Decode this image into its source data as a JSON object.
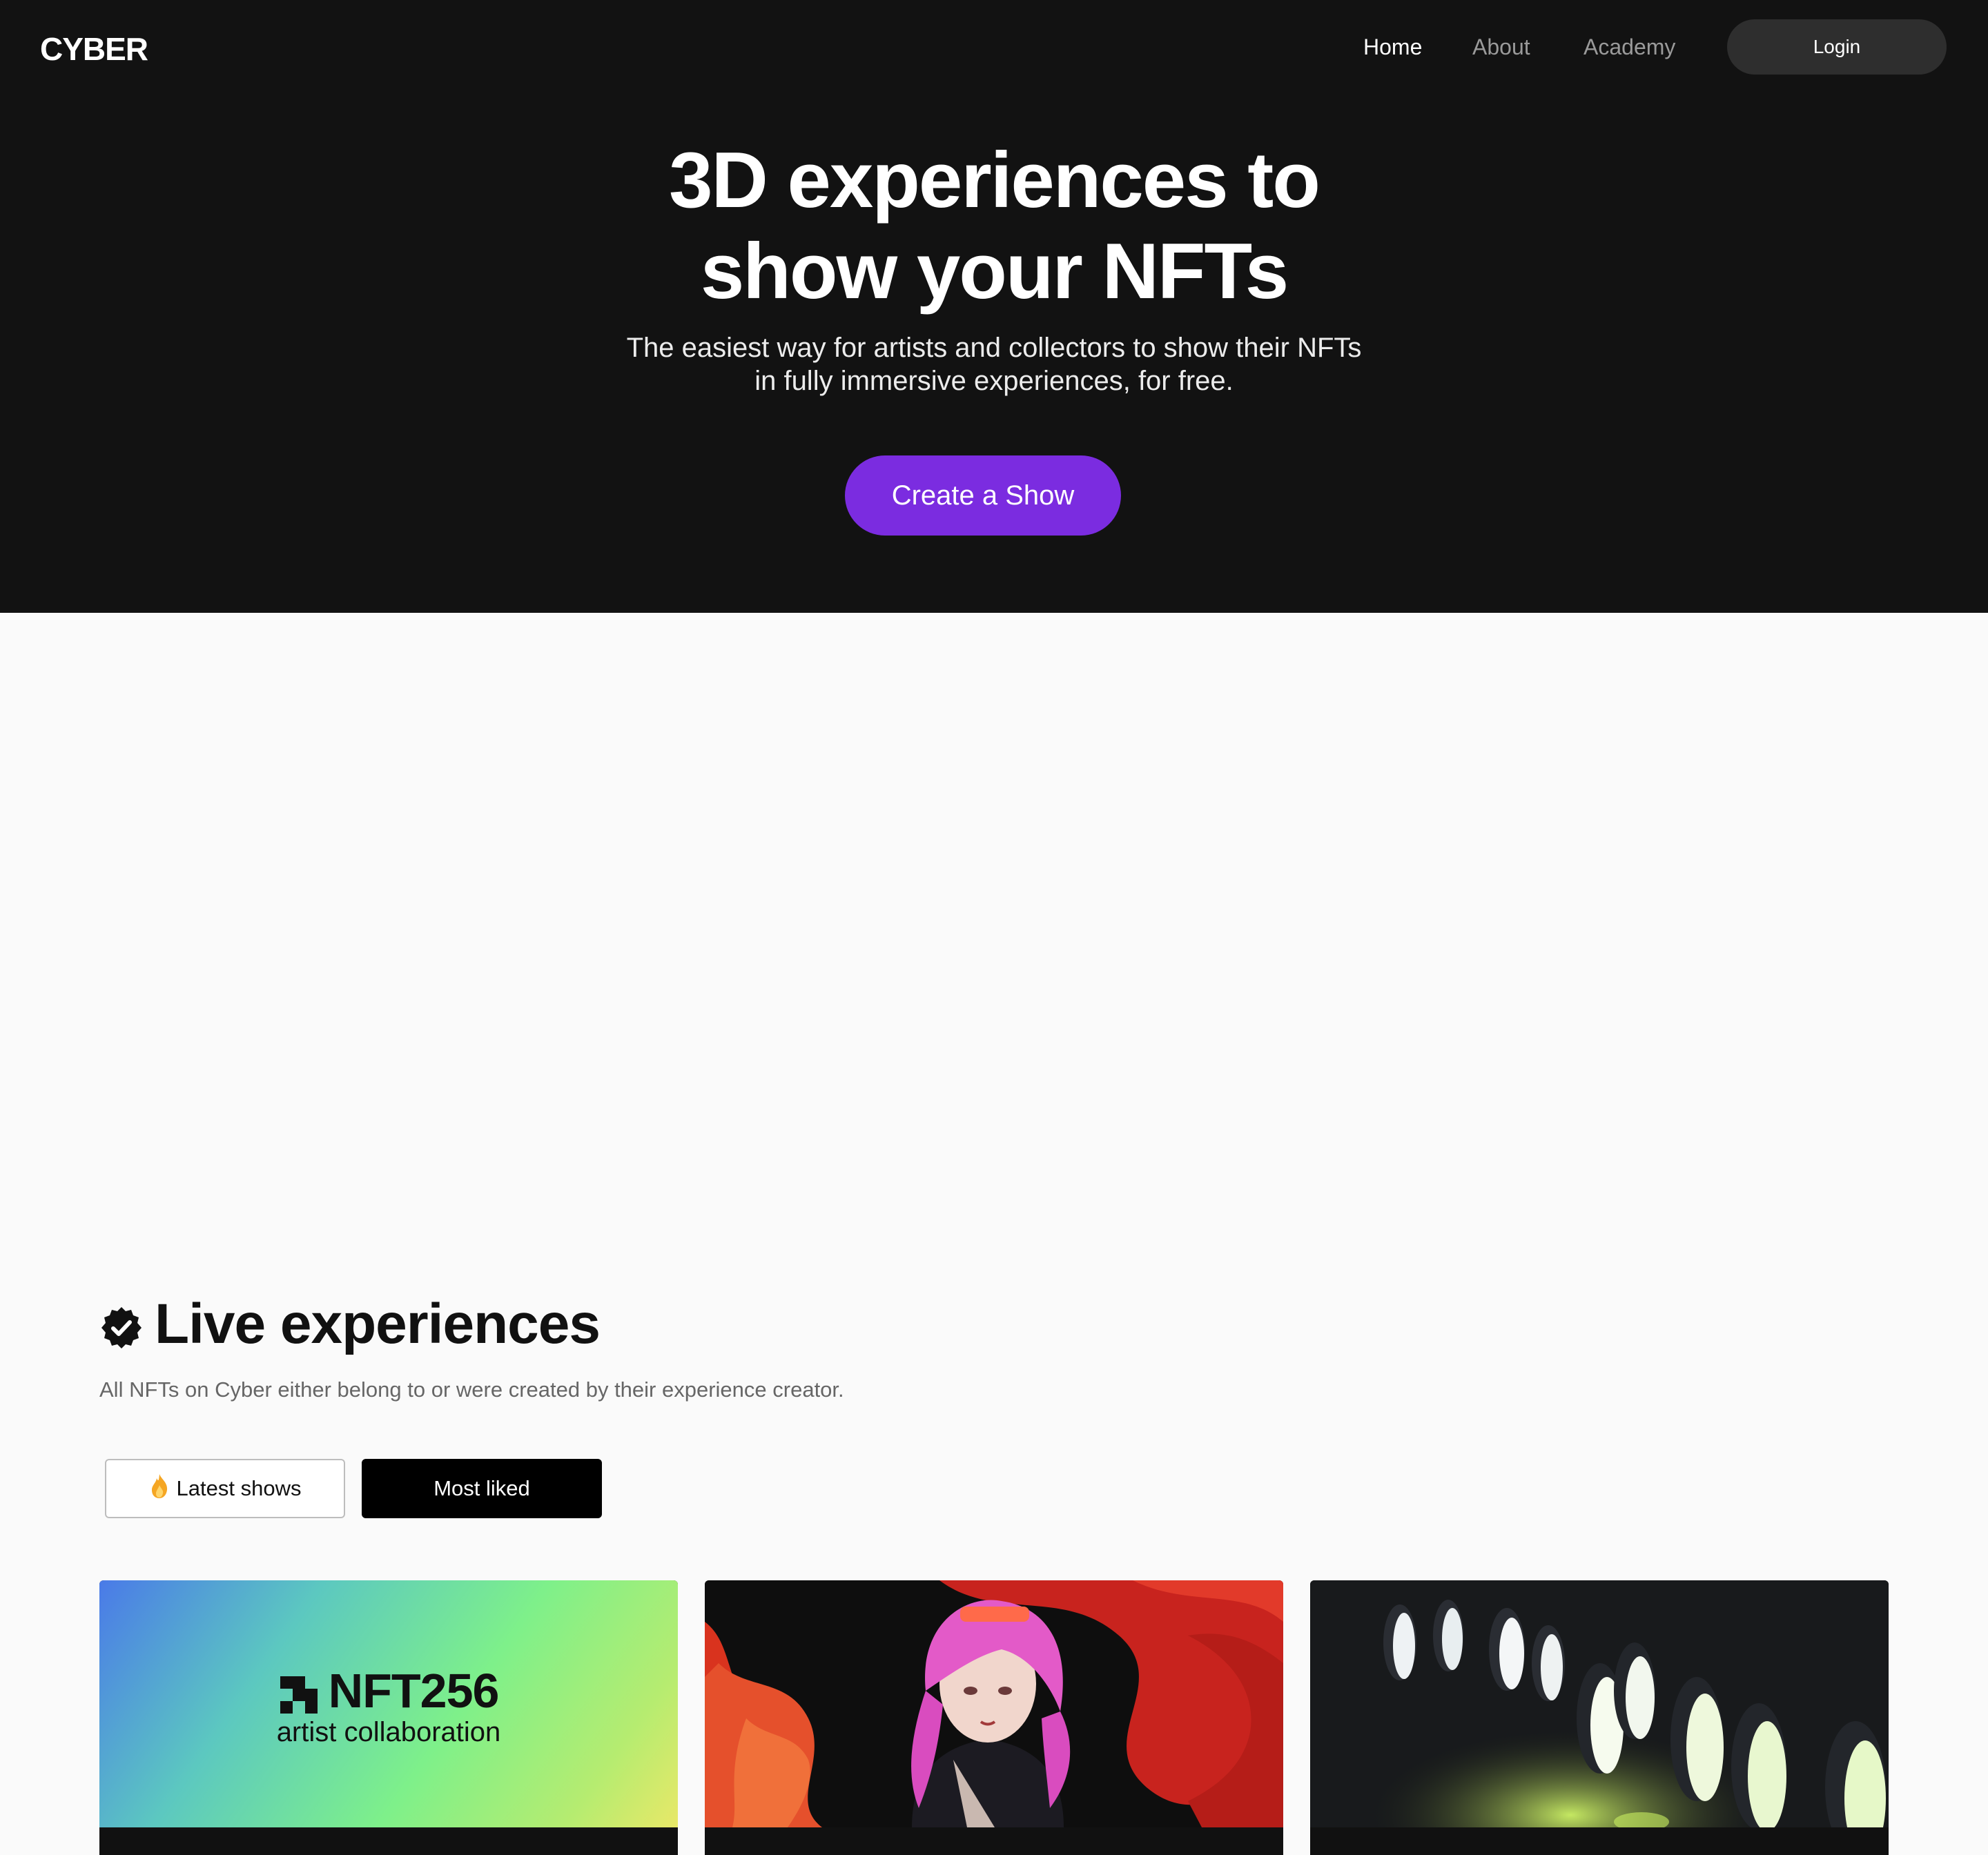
{
  "header": {
    "logo": "CYBER",
    "nav": [
      {
        "label": "Home",
        "active": true
      },
      {
        "label": "About",
        "active": false
      },
      {
        "label": "Academy",
        "active": false
      }
    ],
    "login_label": "Login"
  },
  "hero": {
    "title_line1": "3D experiences to",
    "title_line2": "show your NFTs",
    "subtitle_line1": "The easiest way for artists and collectors to show their NFTs",
    "subtitle_line2": "in fully immersive experiences, for free.",
    "cta_label": "Create a Show",
    "cta_color": "#7b2ce0"
  },
  "live": {
    "title": "Live experiences",
    "badge_icon": "verified-badge-icon",
    "subtitle": "All NFTs on Cyber either belong to or were created by their experience creator.",
    "tabs": [
      {
        "label": "Latest shows",
        "icon": "flame-icon",
        "selected": false
      },
      {
        "label": "Most liked",
        "selected": true
      }
    ]
  },
  "cards": [
    {
      "title": "NFT256",
      "subtitle": "artist collaboration",
      "image": "gradient-banner"
    },
    {
      "image": "anime-girl-red-dragon-artwork"
    },
    {
      "image": "penguins-on-dark-ground-photo"
    }
  ]
}
